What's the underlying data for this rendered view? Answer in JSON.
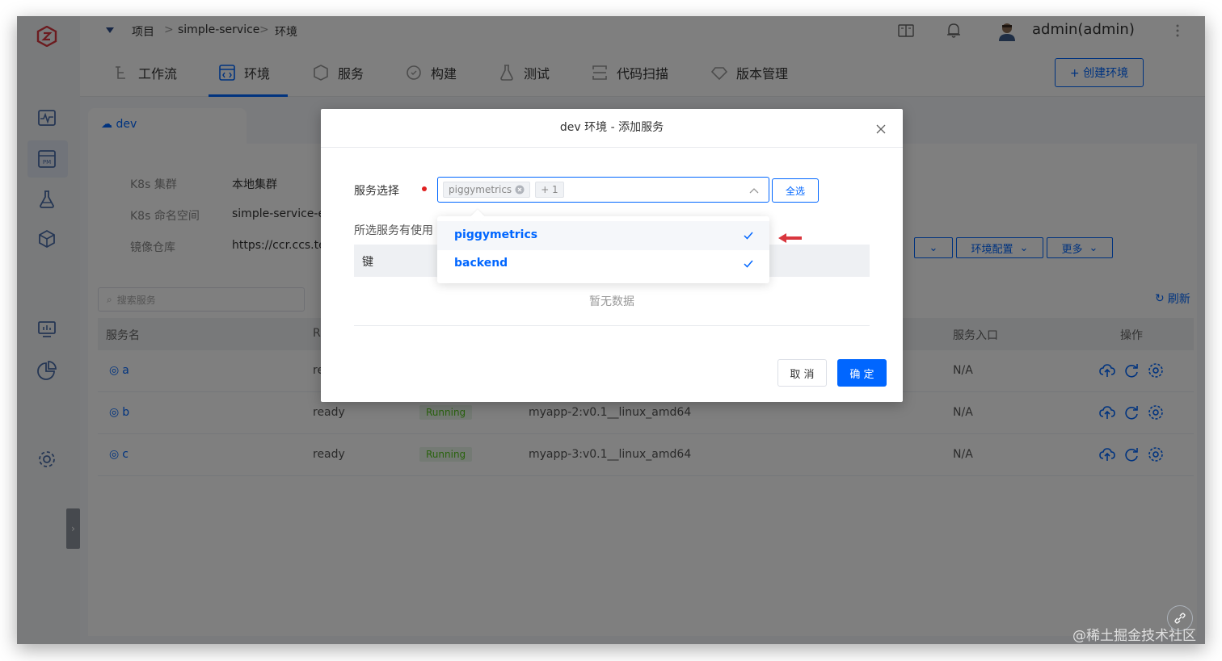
{
  "breadcrumb": {
    "project": "项目",
    "sep": ">",
    "service": "simple-service",
    "env": "环境"
  },
  "user": {
    "name": "admin(admin)"
  },
  "tabs": [
    {
      "label": "工作流",
      "icon": "workflow-icon"
    },
    {
      "label": "环境",
      "icon": "code-window-icon",
      "active": true
    },
    {
      "label": "服务",
      "icon": "cube-icon"
    },
    {
      "label": "构建",
      "icon": "build-icon"
    },
    {
      "label": "测试",
      "icon": "flask-icon"
    },
    {
      "label": "代码扫描",
      "icon": "scan-icon"
    },
    {
      "label": "版本管理",
      "icon": "diamond-icon"
    }
  ],
  "create_env_label": "+ 创建环境",
  "env_tab": {
    "label": "dev"
  },
  "env_info": {
    "cluster_label": "K8s 集群",
    "cluster_value": "本地集群",
    "namespace_label": "K8s 命名空间",
    "namespace_value": "simple-service-er",
    "registry_label": "镜像仓库",
    "registry_value": "https://ccr.ccs.ter"
  },
  "env_buttons": {
    "config": "环境配置",
    "more": "更多"
  },
  "search_placeholder": "搜索服务",
  "refresh_label": "刷新",
  "table": {
    "headers": {
      "name": "服务名",
      "r": "R",
      "entry": "服务入口",
      "ops": "操作"
    },
    "rows": [
      {
        "name": "a",
        "status": "re",
        "running": "",
        "image": "",
        "entry": "N/A"
      },
      {
        "name": "b",
        "status": "ready",
        "running": "Running",
        "image": "myapp-2:v0.1__linux_amd64",
        "entry": "N/A"
      },
      {
        "name": "c",
        "status": "ready",
        "running": "Running",
        "image": "myapp-3:v0.1__linux_amd64",
        "entry": "N/A"
      }
    ]
  },
  "modal": {
    "title": "dev 环境 - 添加服务",
    "field_label": "服务选择",
    "chip": "piggymetrics",
    "chip_more": "+ 1",
    "select_all": "全选",
    "hint": "所选服务有使用",
    "kv_header": "键",
    "empty": "暂无数据",
    "cancel": "取 消",
    "ok": "确 定"
  },
  "dropdown": {
    "items": [
      {
        "label": "piggymetrics",
        "checked": true
      },
      {
        "label": "backend",
        "checked": true
      }
    ]
  },
  "watermark": "@稀土掘金技术社区",
  "colors": {
    "primary": "#0066ff",
    "running_text": "#52c41a",
    "running_bg": "#e8f5e9",
    "required": "#e02020"
  }
}
